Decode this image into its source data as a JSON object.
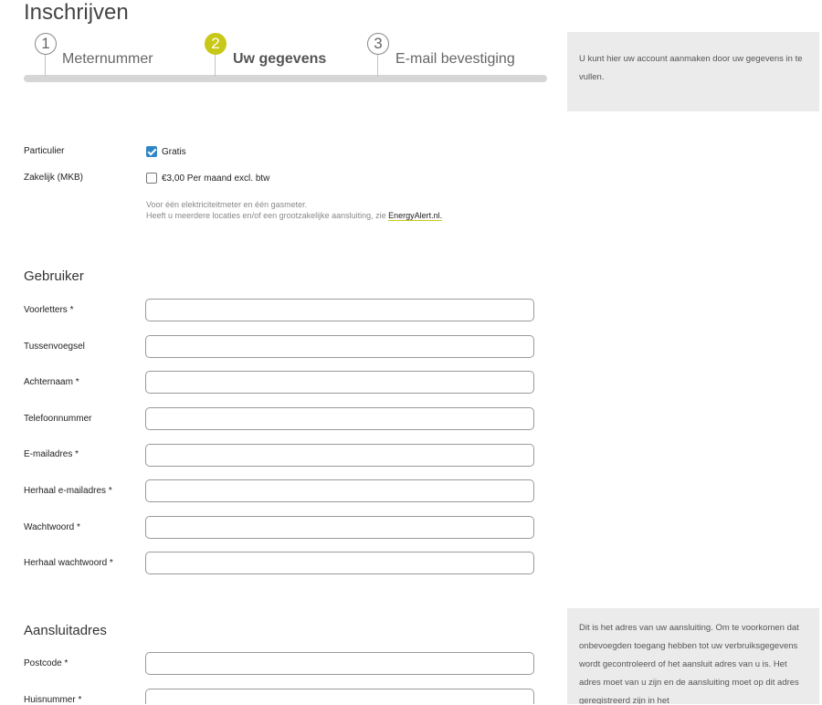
{
  "page_title": "Inschrijven",
  "steps": [
    {
      "number": "1",
      "label": "Meternummer",
      "active": false
    },
    {
      "number": "2",
      "label": "Uw gegevens",
      "active": true
    },
    {
      "number": "3",
      "label": "E-mail bevestiging",
      "active": false
    }
  ],
  "info_top": "U kunt hier uw account aanmaken door uw gegevens in te vullen.",
  "plan": {
    "particulier_label": "Particulier",
    "particulier_option": "Gratis",
    "particulier_checked": true,
    "zakelijk_label": "Zakelijk (MKB)",
    "zakelijk_option": "€3,00 Per maand excl. btw",
    "zakelijk_checked": false,
    "note_line1": "Voor één elektriciteitmeter en één gasmeter.",
    "note_line2_prefix": "Heeft u meerdere locaties en/of een grootzakelijke aansluiting, zie ",
    "note_link": "EnergyAlert.nl."
  },
  "gebruiker": {
    "title": "Gebruiker",
    "fields": [
      {
        "label": "Voorletters *",
        "value": ""
      },
      {
        "label": "Tussenvoegsel",
        "value": ""
      },
      {
        "label": "Achternaam *",
        "value": ""
      },
      {
        "label": "Telefoonnummer",
        "value": ""
      },
      {
        "label": "E-mailadres *",
        "value": ""
      },
      {
        "label": "Herhaal e-mailadres *",
        "value": ""
      },
      {
        "label": "Wachtwoord *",
        "value": ""
      },
      {
        "label": "Herhaal wachtwoord *",
        "value": ""
      }
    ]
  },
  "aansluitadres": {
    "title": "Aansluitadres",
    "fields": [
      {
        "label": "Postcode *",
        "value": ""
      },
      {
        "label": "Huisnummer *",
        "value": ""
      }
    ],
    "info": "Dit is het adres van uw aansluiting. Om te voorkomen dat onbevoegden toegang hebben tot uw verbruiksgegevens wordt gecontroleerd of het aansluit adres van u is. Het adres moet van u zijn en de aansluiting moet op dit adres geregistreerd zijn in het"
  }
}
